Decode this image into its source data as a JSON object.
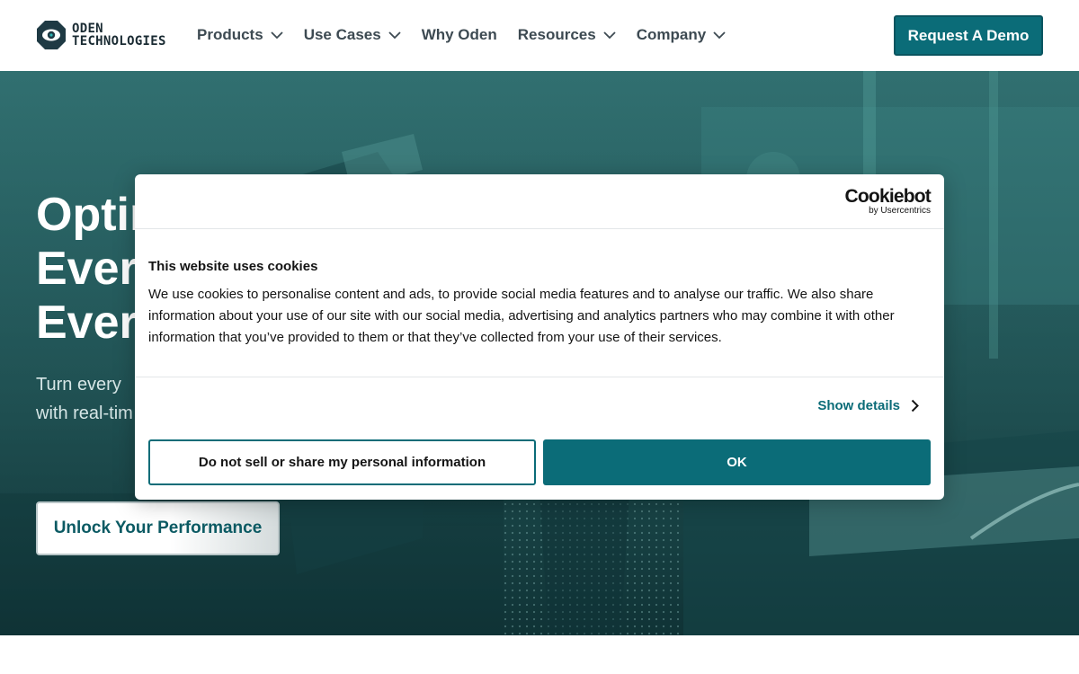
{
  "header": {
    "logo_line1": "ODEN",
    "logo_line2": "TECHNOLOGIES",
    "nav": [
      {
        "label": "Products",
        "has_dropdown": true
      },
      {
        "label": "Use Cases",
        "has_dropdown": true
      },
      {
        "label": "Why Oden",
        "has_dropdown": false
      },
      {
        "label": "Resources",
        "has_dropdown": true
      },
      {
        "label": "Company",
        "has_dropdown": true
      }
    ],
    "demo_button": "Request A Demo"
  },
  "hero": {
    "title_lines": [
      "Optim",
      "Every",
      "Every"
    ],
    "subtitle_lines": [
      "Turn every",
      "with real-tim"
    ],
    "cta": "Unlock Your Performance"
  },
  "cookie_dialog": {
    "brand": "Cookiebot",
    "brand_by": "by Usercentrics",
    "title": "This website uses cookies",
    "body": "We use cookies to personalise content and ads, to provide social media features and to analyse our traffic. We also share information about your use of our site with our social media, advertising and analytics partners who may combine it with other information that you’ve provided to them or that they’ve collected from your use of their services.",
    "show_details": "Show details",
    "deny_button": "Do not sell or share my personal information",
    "ok_button": "OK"
  },
  "colors": {
    "brand_teal": "#0b6c78",
    "hero_overlay": "#245d5f",
    "text_dark": "#3d4a52"
  }
}
